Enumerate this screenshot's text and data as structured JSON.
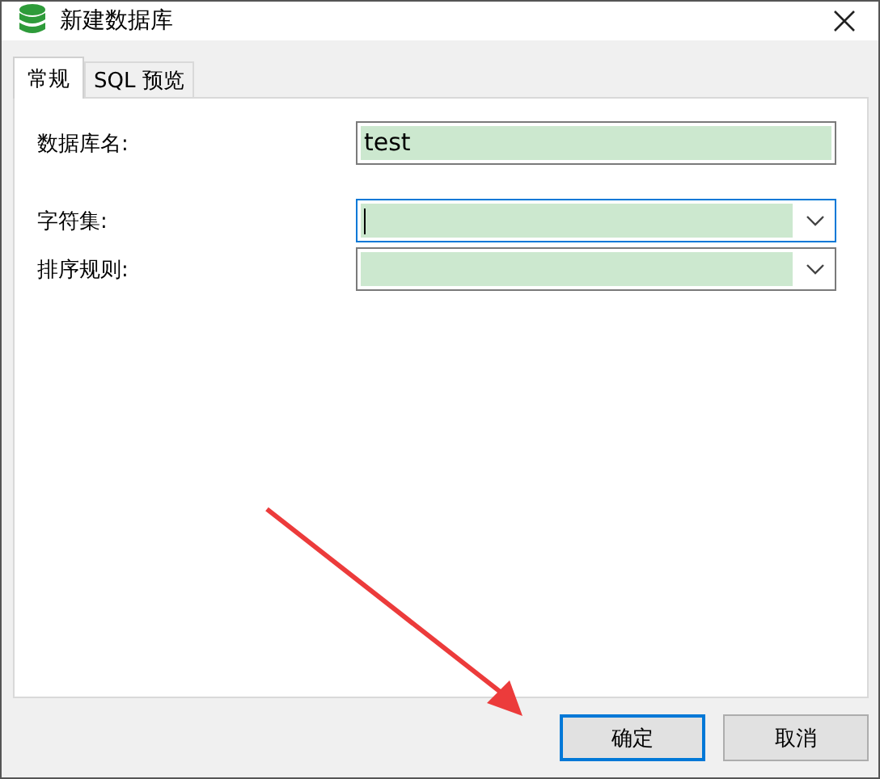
{
  "window": {
    "title": "新建数据库"
  },
  "tabs": [
    {
      "label": "常规",
      "selected": true
    },
    {
      "label": "SQL 预览",
      "selected": false
    }
  ],
  "fields": [
    {
      "kind": "text",
      "label": "数据库名:",
      "value": "test",
      "focused": false
    },
    {
      "kind": "combo",
      "label": "字符集:",
      "focused": true
    },
    {
      "kind": "combo",
      "label": "排序规则:",
      "focused": false
    }
  ],
  "buttons": [
    {
      "label": "确定",
      "default": true
    },
    {
      "label": "取消",
      "default": false
    }
  ]
}
